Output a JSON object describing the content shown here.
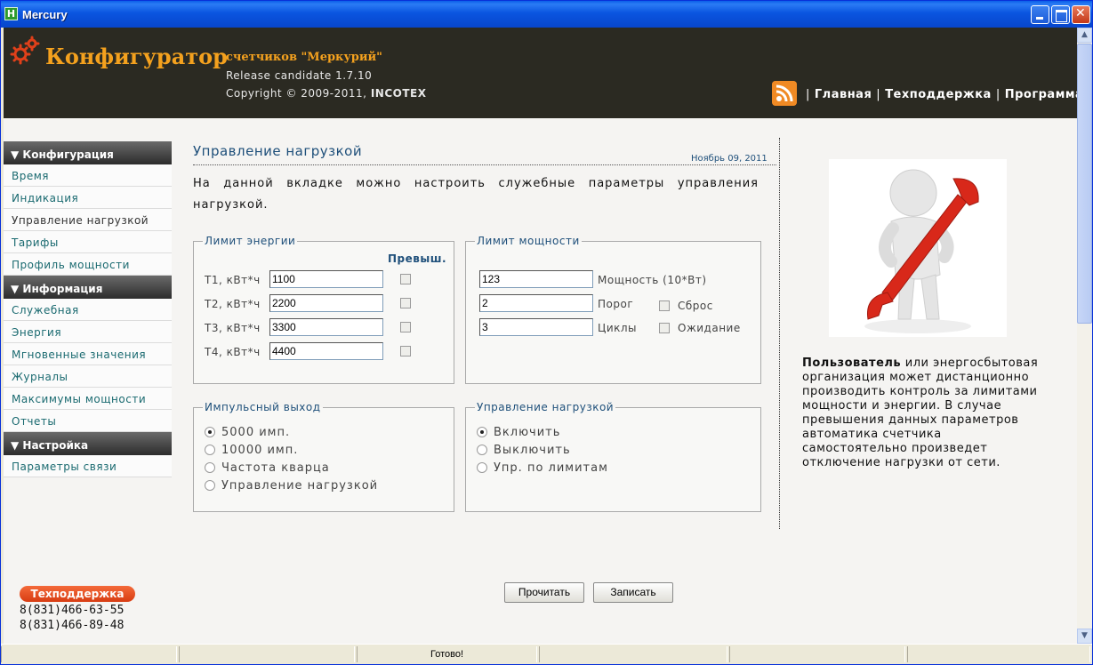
{
  "window": {
    "title": "Mercury",
    "app_icon_letter": "H"
  },
  "header": {
    "title": "Конфигуратор",
    "subtitle": "счетчиков \"Меркурий\"",
    "release": "Release candidate 1.7.10",
    "copyright": "Copyright © 2009-2011,",
    "company": "INCOTEX",
    "nav": [
      "Главная",
      "Техподдержка",
      "Программа"
    ],
    "nav_sep": "|"
  },
  "sidebar": {
    "sections": [
      {
        "title": "▼ Конфигурация",
        "items": [
          "Время",
          "Индикация",
          "Управление нагрузкой",
          "Тарифы",
          "Профиль мощности"
        ]
      },
      {
        "title": "▼ Информация",
        "items": [
          "Служебная",
          "Энергия",
          "Мгновенные значения",
          "Журналы",
          "Максимумы мощности",
          "Отчеты"
        ]
      },
      {
        "title": "▼ Настройка",
        "items": [
          "Параметры связи"
        ]
      }
    ],
    "active_item": "Управление нагрузкой"
  },
  "support": {
    "badge": "Техподдержка",
    "phones": [
      "8(831)466-63-55",
      "8(831)466-89-48"
    ]
  },
  "main": {
    "title": "Управление нагрузкой",
    "date": "Ноябрь 09, 2011",
    "intro": "На данной вкладке можно настроить служебные параметры управления нагрузкой.",
    "energy_limit": {
      "legend": "Лимит энергии",
      "exceed_header": "Превыш.",
      "rows": [
        {
          "label": "T1, кВт*ч",
          "value": "1100",
          "exceeded": false
        },
        {
          "label": "T2, кВт*ч",
          "value": "2200",
          "exceeded": false
        },
        {
          "label": "T3, кВт*ч",
          "value": "3300",
          "exceeded": false
        },
        {
          "label": "T4, кВт*ч",
          "value": "4400",
          "exceeded": false
        }
      ]
    },
    "power_limit": {
      "legend": "Лимит мощности",
      "power_value": "123",
      "power_label": "Мощность (10*Вт)",
      "threshold_value": "2",
      "threshold_label": "Порог",
      "reset_label": "Сброс",
      "cycles_value": "3",
      "cycles_label": "Циклы",
      "wait_label": "Ожидание"
    },
    "pulse_output": {
      "legend": "Импульсный выход",
      "options": [
        "5000 имп.",
        "10000 имп.",
        "Частота кварца",
        "Управление нагрузкой"
      ],
      "selected": 0
    },
    "load_control": {
      "legend": "Управление нагрузкой",
      "options": [
        "Включить",
        "Выключить",
        "Упр. по лимитам"
      ],
      "selected": 0
    },
    "buttons": {
      "read": "Прочитать",
      "write": "Записать"
    }
  },
  "info": {
    "bold": "Пользователь",
    "text": " или энергосбытовая организация может дистанционно производить контроль за лимитами мощности и энергии. В случае превышения данных параметров автоматика счетчика самостоятельно произведет отключение нагрузки от сети."
  },
  "statusbar": {
    "status": "Готово!"
  },
  "colors": {
    "header_bg": "#2b2a22",
    "accent_orange": "#f4a11e",
    "link_teal": "#1a6a70",
    "title_blue": "#1e4f7a"
  }
}
